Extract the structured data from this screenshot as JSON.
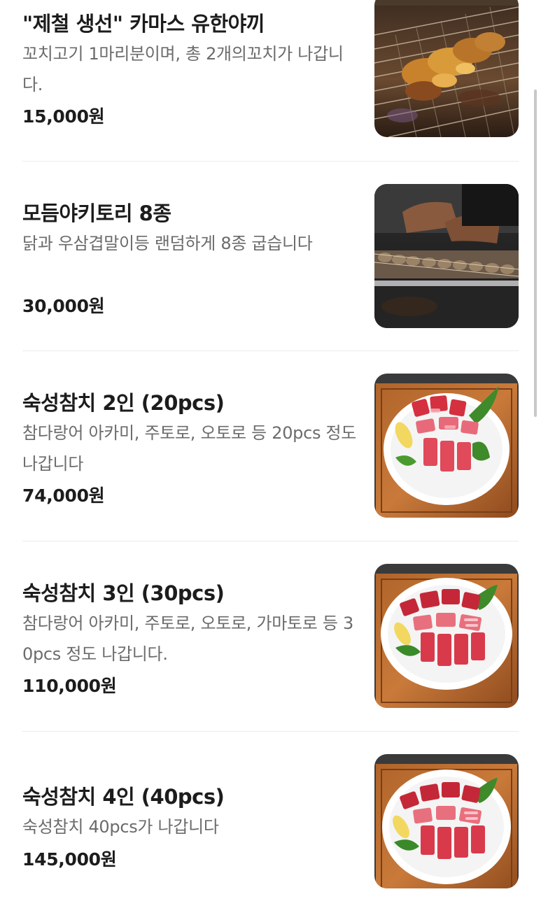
{
  "menu": {
    "items": [
      {
        "name": "\"제철 생선\" 카마스 유한야끼",
        "description": "꼬치고기 1마리분이며, 총 2개의꼬치가 나갑니다.",
        "price": "15,000원",
        "photo": "grilled-fish-skewers"
      },
      {
        "name": "모듬야키토리 8종",
        "description": "닭과 우삼겹말이등 랜덤하게 8종 굽습니다",
        "price": "30,000원",
        "photo": "yakitori-grill"
      },
      {
        "name": "숙성참치 2인 (20pcs)",
        "description": "참다랑어 아카미, 주토로, 오토로 등 20pcs 정도 나갑니다",
        "price": "74,000원",
        "photo": "tuna-sashimi-platter"
      },
      {
        "name": "숙성참치 3인 (30pcs)",
        "description": "참다랑어 아카미, 주토로, 오토로, 가마토로 등 30pcs 정도 나갑니다.",
        "price": "110,000원",
        "photo": "tuna-sashimi-platter"
      },
      {
        "name": "숙성참치 4인 (40pcs)",
        "description": "숙성참치 40pcs가 나갑니다",
        "price": "145,000원",
        "photo": "tuna-sashimi-platter"
      }
    ]
  }
}
